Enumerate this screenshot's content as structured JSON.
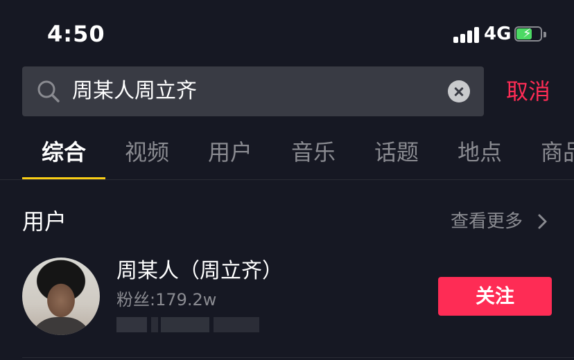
{
  "status_bar": {
    "time": "4:50",
    "network": "4G",
    "battery_level_percent": 60,
    "battery_charging": true
  },
  "search": {
    "query": "周某人周立齐",
    "cancel_label": "取消"
  },
  "tabs": [
    {
      "label": "综合",
      "active": true
    },
    {
      "label": "视频",
      "active": false
    },
    {
      "label": "用户",
      "active": false
    },
    {
      "label": "音乐",
      "active": false
    },
    {
      "label": "话题",
      "active": false
    },
    {
      "label": "地点",
      "active": false
    },
    {
      "label": "商品",
      "active": false
    }
  ],
  "users_section": {
    "title": "用户",
    "see_more_label": "查看更多",
    "user": {
      "name": "周某人（周立齐）",
      "fans": "粉丝:179.2w",
      "follow_label": "关注"
    }
  },
  "colors": {
    "background": "#161823",
    "accent": "#fe2c55",
    "tab_indicator": "#face15",
    "muted_text": "#8a8b91",
    "search_bg": "#393b44"
  }
}
